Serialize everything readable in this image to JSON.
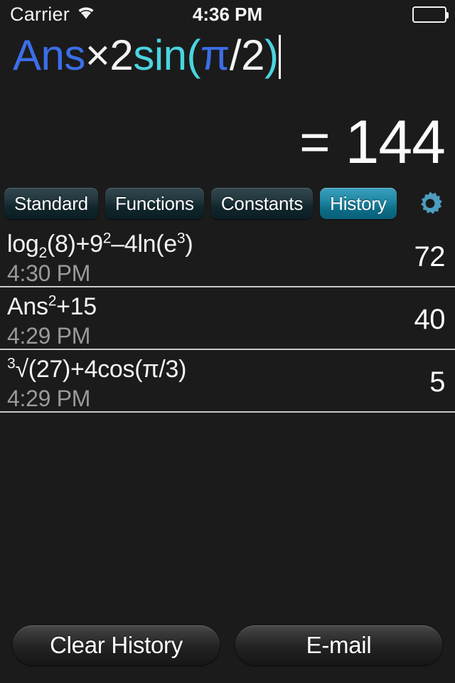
{
  "status_bar": {
    "carrier": "Carrier",
    "wifi_icon": "wifi-icon",
    "time": "4:36 PM",
    "battery_icon": "battery-full-icon"
  },
  "colors": {
    "background": "#1b1b1b",
    "accent_blue": "#3b6ee8",
    "accent_cyan": "#4ad4e0",
    "text_white": "#f4f4f4",
    "timestamp_gray": "#9a9a9a",
    "tab_active_teal": "#2289a6",
    "tab_inactive_teal": "#25393f",
    "gear_teal": "#4d9dbf",
    "divider": "#c9c9c9"
  },
  "expression": {
    "tokens": [
      {
        "text": "Ans",
        "color": "#3b6ee8"
      },
      {
        "text": "×2",
        "color": "#f4f4f4"
      },
      {
        "text": "sin(",
        "color": "#4ad4e0"
      },
      {
        "text": "π",
        "color": "#3b6ee8"
      },
      {
        "text": "/2",
        "color": "#f4f4f4"
      },
      {
        "text": ")",
        "color": "#4ad4e0"
      }
    ],
    "plain_text": "Ans×2sin(π/2)",
    "caret_visible": true
  },
  "result": {
    "equals_sign": "=",
    "value": "144"
  },
  "tabs": [
    {
      "label": "Standard",
      "active": false,
      "name": "tab-standard"
    },
    {
      "label": "Functions",
      "active": false,
      "name": "tab-functions"
    },
    {
      "label": "Constants",
      "active": false,
      "name": "tab-constants"
    },
    {
      "label": "History",
      "active": true,
      "name": "tab-history"
    }
  ],
  "settings_button": {
    "icon": "gear-icon"
  },
  "history": [
    {
      "expression_parts": [
        {
          "text": "log",
          "style": "normal"
        },
        {
          "text": "2",
          "style": "sub"
        },
        {
          "text": "(8)+9",
          "style": "normal"
        },
        {
          "text": "2",
          "style": "sup"
        },
        {
          "text": "–4ln(e",
          "style": "normal"
        },
        {
          "text": "3",
          "style": "sup"
        },
        {
          "text": ")",
          "style": "normal"
        }
      ],
      "expression_text": "log₂(8)+9²–4ln(e³)",
      "time": "4:30 PM",
      "result": "72"
    },
    {
      "expression_parts": [
        {
          "text": "Ans",
          "style": "normal"
        },
        {
          "text": "2",
          "style": "sup"
        },
        {
          "text": "+15",
          "style": "normal"
        }
      ],
      "expression_text": "Ans²+15",
      "time": "4:29 PM",
      "result": "40"
    },
    {
      "expression_parts": [
        {
          "text": "3",
          "style": "sup"
        },
        {
          "text": "√(27)+4cos(π/3)",
          "style": "normal"
        }
      ],
      "expression_text": "³√(27)+4cos(π/3)",
      "time": "4:29 PM",
      "result": "5"
    }
  ],
  "bottom_buttons": {
    "clear_history": "Clear History",
    "email": "E-mail"
  }
}
